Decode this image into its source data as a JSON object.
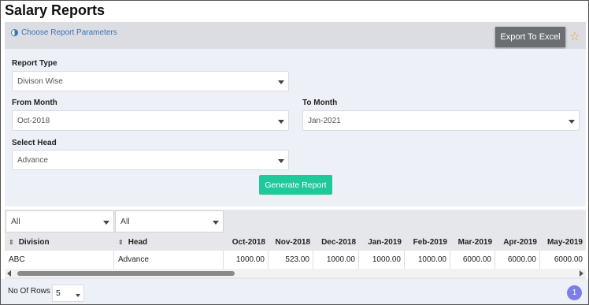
{
  "page": {
    "title": "Salary Reports"
  },
  "params": {
    "link_label": "Choose Report Parameters",
    "export_label": "Export To Excel",
    "generate_label": "Generate Report",
    "fields": {
      "report_type": {
        "label": "Report Type",
        "value": "Divison Wise"
      },
      "from_month": {
        "label": "From Month",
        "value": "Oct-2018"
      },
      "to_month": {
        "label": "To Month",
        "value": "Jan-2021"
      },
      "select_head": {
        "label": "Select Head",
        "value": "Advance"
      }
    }
  },
  "grid": {
    "filters": [
      "All",
      "All"
    ],
    "columns": [
      "Division",
      "Head",
      "Oct-2018",
      "Nov-2018",
      "Dec-2018",
      "Jan-2019",
      "Feb-2019",
      "Mar-2019",
      "Apr-2019",
      "May-2019"
    ],
    "rows": [
      [
        "ABC",
        "Advance",
        "1000.00",
        "523.00",
        "1000.00",
        "1000.00",
        "1000.00",
        "6000.00",
        "6000.00",
        "6000.00"
      ]
    ],
    "scrollbar_position": 0.02
  },
  "footer": {
    "rows_label": "No Of Rows :",
    "rows_value": "5",
    "current_page": "1"
  },
  "colors": {
    "export_button": "#6b6e73",
    "generate_button": "#20c99a",
    "pager": "#7b7ee8",
    "link": "#3a73b5",
    "star": "#f0a020"
  },
  "icons": [
    "report-params-icon",
    "star-icon",
    "chevron-down-icon",
    "sort-icon",
    "scroll-left-icon",
    "scroll-right-icon"
  ]
}
